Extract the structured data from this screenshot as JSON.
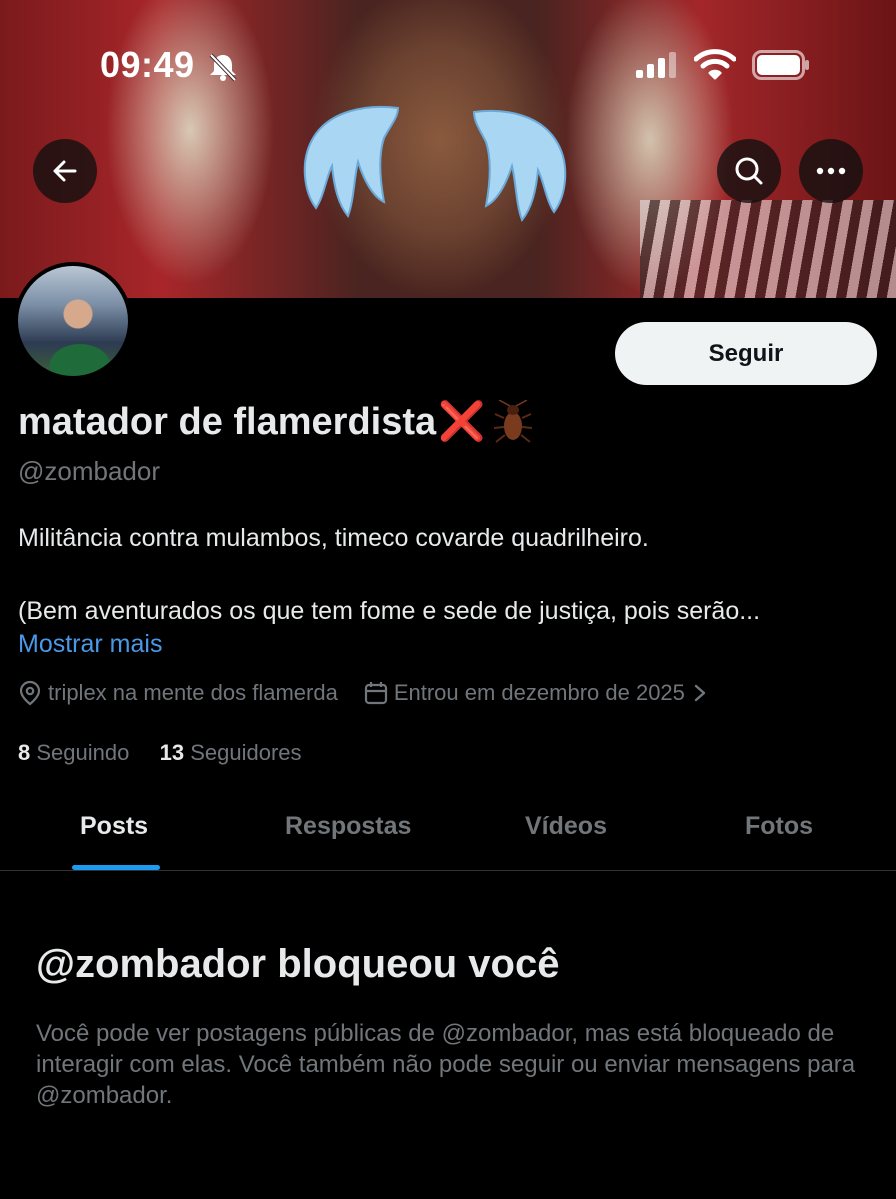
{
  "status_bar": {
    "time": "09:49",
    "icons": [
      "bell-off-icon",
      "cellular-signal-icon",
      "wifi-icon",
      "battery-icon"
    ]
  },
  "header": {
    "back_icon": "arrow-left-icon",
    "search_icon": "search-icon",
    "more_icon": "more-horizontal-icon"
  },
  "profile": {
    "display_name": "matador de flamerdista",
    "name_emojis": [
      "❌",
      "🪳"
    ],
    "handle": "@zombador",
    "bio_line1": "Militância contra mulambos, timeco covarde quadrilheiro.",
    "bio_line2": "(Bem aventurados os que tem fome e sede de justiça, pois serão...",
    "show_more": "Mostrar mais",
    "location": "triplex na mente dos flamerda",
    "joined": "Entrou em dezembro de 2025",
    "following_count": "8",
    "following_label": "Seguindo",
    "followers_count": "13",
    "followers_label": "Seguidores",
    "follow_button": "Seguir"
  },
  "tabs": [
    {
      "label": "Posts",
      "active": true
    },
    {
      "label": "Respostas",
      "active": false
    },
    {
      "label": "Vídeos",
      "active": false
    },
    {
      "label": "Fotos",
      "active": false
    }
  ],
  "blocked": {
    "title": "@zombador bloqueou você",
    "message": "Você pode ver postagens públicas de @zombador, mas está bloqueado de interagir com elas. Você também não pode seguir ou enviar mensagens para @zombador."
  },
  "colors": {
    "background": "#000000",
    "text": "#e7e9ea",
    "muted": "#71767b",
    "link": "#4a99e9",
    "accent": "#1d9bf0",
    "button_bg": "#eff3f4"
  }
}
